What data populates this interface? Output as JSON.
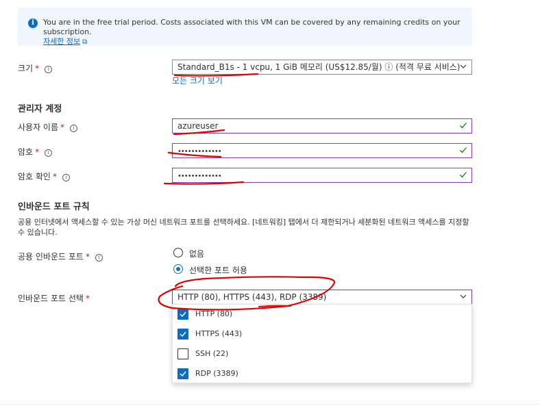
{
  "banner": {
    "text": "You are in the free trial period. Costs associated with this VM can be covered by any remaining credits on your subscription.",
    "link": "자세한 정보"
  },
  "size": {
    "label": "크기",
    "value": "Standard_B1s - 1 vcpu, 1 GiB 메모리 (US$12.85/월) ⓘ (적격 무료 서비스)",
    "link": "모든 크기 보기"
  },
  "admin": {
    "section": "관리자 계정",
    "username_label": "사용자 이름",
    "username_value": "azureuser",
    "password_label": "암호",
    "password_value": "•••••••••••••",
    "confirm_label": "암호 확인",
    "confirm_value": "•••••••••••••"
  },
  "inbound": {
    "section": "인바운드 포트 규칙",
    "description": "공용 인터넷에서 액세스할 수 있는 가상 머신 네트워크 포트를 선택하세요. [네트워킹] 탭에서 더 제한되거나 세분화된 네트워크 액세스를 지정할 수 있습니다.",
    "public_label": "공용 인바운드 포트",
    "radio_none": "없음",
    "radio_allow": "선택한 포트 허용",
    "select_label": "인바운드 포트 선택",
    "select_value": "HTTP (80), HTTPS (443), RDP (3389)",
    "options": [
      {
        "label": "HTTP (80)",
        "checked": true
      },
      {
        "label": "HTTPS (443)",
        "checked": true
      },
      {
        "label": "SSH (22)",
        "checked": false
      },
      {
        "label": "RDP (3389)",
        "checked": true
      }
    ]
  },
  "colors": {
    "accent": "#0f6cbd",
    "annotation": "#e00000",
    "success": "#107c10"
  },
  "required_mark": "*",
  "tip_glyph": "i"
}
